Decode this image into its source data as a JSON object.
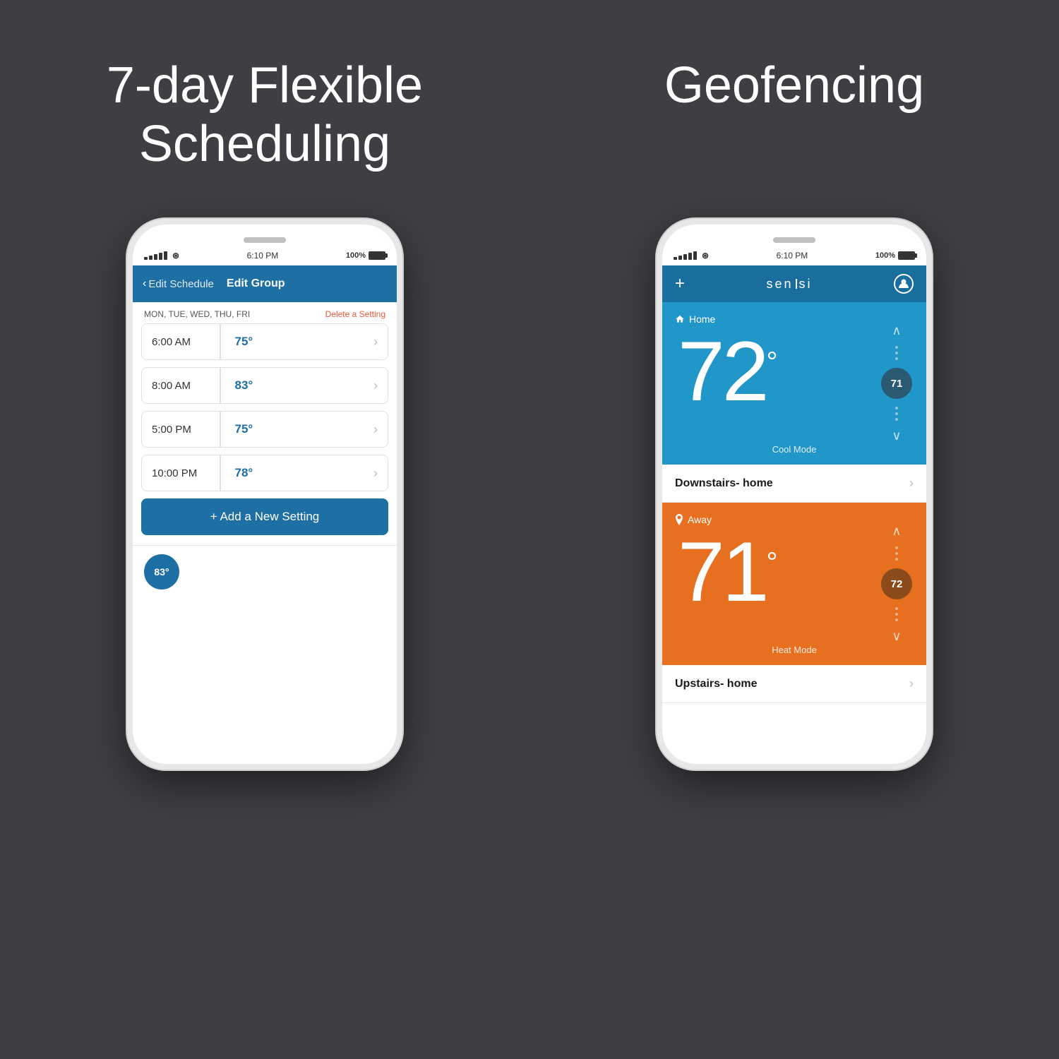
{
  "page": {
    "background_color": "#3d3f43",
    "left_feature_title": "7-day Flexible Scheduling",
    "right_feature_title": "Geofencing"
  },
  "left_phone": {
    "status_bar": {
      "time": "6:10 PM",
      "battery": "100%"
    },
    "nav": {
      "back_label": "Edit Schedule",
      "title": "Edit Group"
    },
    "days": "MON, TUE, WED, THU, FRI",
    "delete_link": "Delete a Setting",
    "schedule_items": [
      {
        "time": "6:00 AM",
        "temp": "75°"
      },
      {
        "time": "8:00 AM",
        "temp": "83°"
      },
      {
        "time": "5:00 PM",
        "temp": "75°"
      },
      {
        "time": "10:00 PM",
        "temp": "78°"
      }
    ],
    "add_button": "+ Add a New Setting",
    "bottom_circle_temp": "83°"
  },
  "right_phone": {
    "status_bar": {
      "time": "6:10 PM",
      "battery": "100%"
    },
    "nav": {
      "plus": "+",
      "logo": "sen|si",
      "logo_text": "sen si"
    },
    "cards": [
      {
        "mode_icon": "🏠",
        "location": "Home",
        "temp": "72",
        "degree_symbol": "°",
        "set_temp": "71",
        "mode_label": "Cool Mode",
        "type": "cool",
        "device_name": "Downstairs- home"
      },
      {
        "mode_icon": "📍",
        "location": "Away",
        "temp": "71",
        "degree_symbol": "°",
        "set_temp": "72",
        "mode_label": "Heat Mode",
        "type": "heat",
        "device_name": "Upstairs- home"
      }
    ]
  }
}
